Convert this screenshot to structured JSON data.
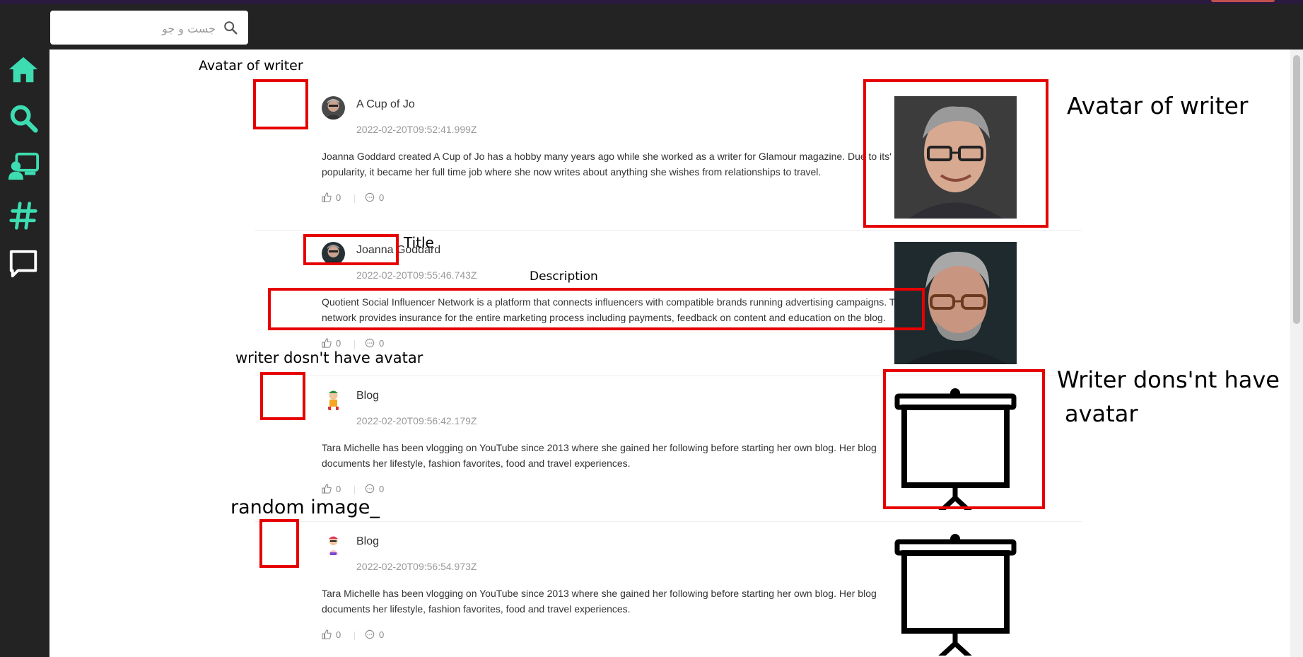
{
  "search": {
    "placeholder": "جست و جو"
  },
  "sidebar": {
    "items": [
      {
        "icon": "home-icon"
      },
      {
        "icon": "search-icon"
      },
      {
        "icon": "user-screen-icon"
      },
      {
        "icon": "hashtag-icon"
      },
      {
        "icon": "message-icon"
      }
    ],
    "accent": "#3ddcb1"
  },
  "posts": [
    {
      "title": "A Cup of Jo",
      "date": "2022-02-20T09:52:41.999Z",
      "description": "Joanna Goddard created A Cup of Jo has a hobby many years ago while she worked as a writer for Glamour magazine. Due to its' popularity, it became her full time job where she now writes about anything she wishes from relationships to travel.",
      "likes": "0",
      "comments": "0"
    },
    {
      "title": "Joanna Goddard",
      "date": "2022-02-20T09:55:46.743Z",
      "description": "Quotient Social Influencer Network is a platform that connects influencers with compatible brands running advertising campaigns. The network provides insurance for the entire marketing process including payments, feedback on content and education on the blog.",
      "likes": "0",
      "comments": "0"
    },
    {
      "title": "Blog",
      "date": "2022-02-20T09:56:42.179Z",
      "description": "Tara Michelle has been vlogging on YouTube since 2013 where she gained her following before starting her own blog. Her blog documents her lifestyle, fashion favorites, food and travel experiences.",
      "likes": "0",
      "comments": "0"
    },
    {
      "title": "Blog",
      "date": "2022-02-20T09:56:54.973Z",
      "description": "Tara Michelle has been vlogging on YouTube since 2013 where she gained her following before starting her own blog. Her blog documents her lifestyle, fashion favorites, food and travel experiences.",
      "likes": "0",
      "comments": "0"
    }
  ],
  "annotations": {
    "avatar_of_writer_small": "Avatar of writer",
    "avatar_of_writer_large": "Avatar of writer",
    "title": "Title",
    "description": "Description",
    "writer_no_avatar_small": "writer dosn't have avatar",
    "writer_no_avatar_large_1": "Writer dons'nt have",
    "writer_no_avatar_large_2": "avatar",
    "random_image": "random image_"
  },
  "colors": {
    "annotation_box": "#e60000",
    "background": "#232323"
  }
}
